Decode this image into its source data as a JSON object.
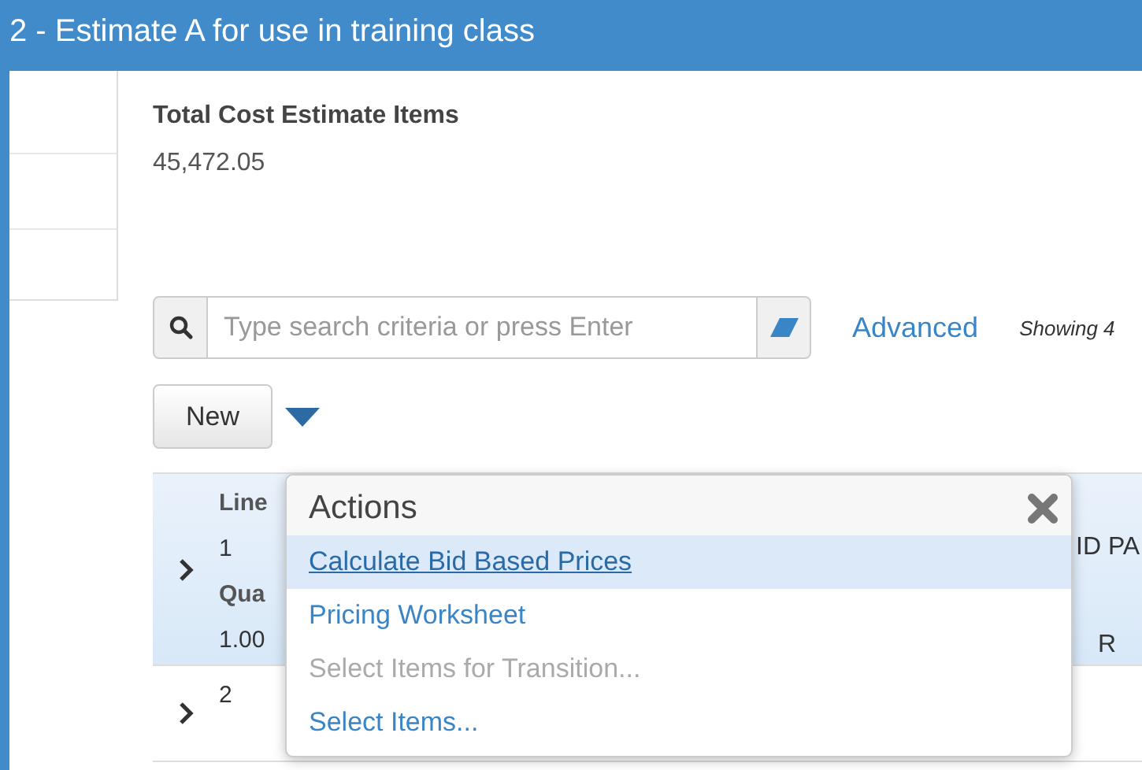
{
  "window": {
    "title": "2 - Estimate A for use in training class"
  },
  "summary": {
    "label": "Total Cost Estimate Items",
    "value": "45,472.05"
  },
  "search": {
    "placeholder": "Type search criteria or press Enter",
    "advanced_link": "Advanced",
    "showing": "Showing 4"
  },
  "new_button": {
    "label": "New"
  },
  "table": {
    "rows": [
      {
        "selected": true,
        "line_label": "Line",
        "line": "1",
        "quantity_label": "Qua",
        "quantity": "1.00",
        "column_3": "ID PA",
        "column_4": "R"
      },
      {
        "selected": false,
        "line": "2"
      }
    ]
  },
  "actions_menu": {
    "title": "Actions",
    "items": [
      {
        "label": "Calculate Bid Based Prices",
        "selected": true,
        "disabled": false
      },
      {
        "label": "Pricing Worksheet",
        "selected": false,
        "disabled": false
      },
      {
        "label": "Select Items for Transition...",
        "selected": false,
        "disabled": true
      },
      {
        "label": "Select Items...",
        "selected": false,
        "disabled": false
      }
    ]
  }
}
